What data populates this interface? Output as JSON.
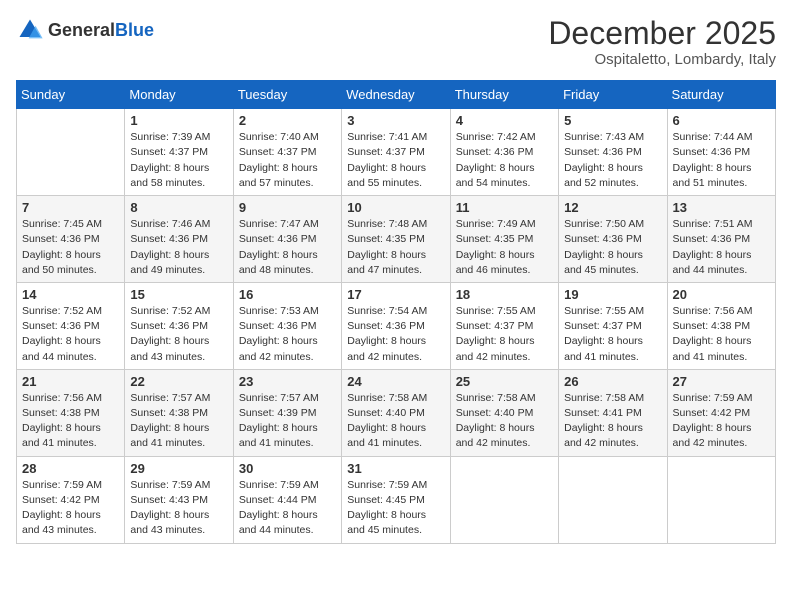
{
  "logo": {
    "general": "General",
    "blue": "Blue"
  },
  "title": "December 2025",
  "subtitle": "Ospitaletto, Lombardy, Italy",
  "days_of_week": [
    "Sunday",
    "Monday",
    "Tuesday",
    "Wednesday",
    "Thursday",
    "Friday",
    "Saturday"
  ],
  "weeks": [
    [
      {
        "day": "",
        "info": ""
      },
      {
        "day": "1",
        "info": "Sunrise: 7:39 AM\nSunset: 4:37 PM\nDaylight: 8 hours\nand 58 minutes."
      },
      {
        "day": "2",
        "info": "Sunrise: 7:40 AM\nSunset: 4:37 PM\nDaylight: 8 hours\nand 57 minutes."
      },
      {
        "day": "3",
        "info": "Sunrise: 7:41 AM\nSunset: 4:37 PM\nDaylight: 8 hours\nand 55 minutes."
      },
      {
        "day": "4",
        "info": "Sunrise: 7:42 AM\nSunset: 4:36 PM\nDaylight: 8 hours\nand 54 minutes."
      },
      {
        "day": "5",
        "info": "Sunrise: 7:43 AM\nSunset: 4:36 PM\nDaylight: 8 hours\nand 52 minutes."
      },
      {
        "day": "6",
        "info": "Sunrise: 7:44 AM\nSunset: 4:36 PM\nDaylight: 8 hours\nand 51 minutes."
      }
    ],
    [
      {
        "day": "7",
        "info": "Sunrise: 7:45 AM\nSunset: 4:36 PM\nDaylight: 8 hours\nand 50 minutes."
      },
      {
        "day": "8",
        "info": "Sunrise: 7:46 AM\nSunset: 4:36 PM\nDaylight: 8 hours\nand 49 minutes."
      },
      {
        "day": "9",
        "info": "Sunrise: 7:47 AM\nSunset: 4:36 PM\nDaylight: 8 hours\nand 48 minutes."
      },
      {
        "day": "10",
        "info": "Sunrise: 7:48 AM\nSunset: 4:35 PM\nDaylight: 8 hours\nand 47 minutes."
      },
      {
        "day": "11",
        "info": "Sunrise: 7:49 AM\nSunset: 4:35 PM\nDaylight: 8 hours\nand 46 minutes."
      },
      {
        "day": "12",
        "info": "Sunrise: 7:50 AM\nSunset: 4:36 PM\nDaylight: 8 hours\nand 45 minutes."
      },
      {
        "day": "13",
        "info": "Sunrise: 7:51 AM\nSunset: 4:36 PM\nDaylight: 8 hours\nand 44 minutes."
      }
    ],
    [
      {
        "day": "14",
        "info": "Sunrise: 7:52 AM\nSunset: 4:36 PM\nDaylight: 8 hours\nand 44 minutes."
      },
      {
        "day": "15",
        "info": "Sunrise: 7:52 AM\nSunset: 4:36 PM\nDaylight: 8 hours\nand 43 minutes."
      },
      {
        "day": "16",
        "info": "Sunrise: 7:53 AM\nSunset: 4:36 PM\nDaylight: 8 hours\nand 42 minutes."
      },
      {
        "day": "17",
        "info": "Sunrise: 7:54 AM\nSunset: 4:36 PM\nDaylight: 8 hours\nand 42 minutes."
      },
      {
        "day": "18",
        "info": "Sunrise: 7:55 AM\nSunset: 4:37 PM\nDaylight: 8 hours\nand 42 minutes."
      },
      {
        "day": "19",
        "info": "Sunrise: 7:55 AM\nSunset: 4:37 PM\nDaylight: 8 hours\nand 41 minutes."
      },
      {
        "day": "20",
        "info": "Sunrise: 7:56 AM\nSunset: 4:38 PM\nDaylight: 8 hours\nand 41 minutes."
      }
    ],
    [
      {
        "day": "21",
        "info": "Sunrise: 7:56 AM\nSunset: 4:38 PM\nDaylight: 8 hours\nand 41 minutes."
      },
      {
        "day": "22",
        "info": "Sunrise: 7:57 AM\nSunset: 4:38 PM\nDaylight: 8 hours\nand 41 minutes."
      },
      {
        "day": "23",
        "info": "Sunrise: 7:57 AM\nSunset: 4:39 PM\nDaylight: 8 hours\nand 41 minutes."
      },
      {
        "day": "24",
        "info": "Sunrise: 7:58 AM\nSunset: 4:40 PM\nDaylight: 8 hours\nand 41 minutes."
      },
      {
        "day": "25",
        "info": "Sunrise: 7:58 AM\nSunset: 4:40 PM\nDaylight: 8 hours\nand 42 minutes."
      },
      {
        "day": "26",
        "info": "Sunrise: 7:58 AM\nSunset: 4:41 PM\nDaylight: 8 hours\nand 42 minutes."
      },
      {
        "day": "27",
        "info": "Sunrise: 7:59 AM\nSunset: 4:42 PM\nDaylight: 8 hours\nand 42 minutes."
      }
    ],
    [
      {
        "day": "28",
        "info": "Sunrise: 7:59 AM\nSunset: 4:42 PM\nDaylight: 8 hours\nand 43 minutes."
      },
      {
        "day": "29",
        "info": "Sunrise: 7:59 AM\nSunset: 4:43 PM\nDaylight: 8 hours\nand 43 minutes."
      },
      {
        "day": "30",
        "info": "Sunrise: 7:59 AM\nSunset: 4:44 PM\nDaylight: 8 hours\nand 44 minutes."
      },
      {
        "day": "31",
        "info": "Sunrise: 7:59 AM\nSunset: 4:45 PM\nDaylight: 8 hours\nand 45 minutes."
      },
      {
        "day": "",
        "info": ""
      },
      {
        "day": "",
        "info": ""
      },
      {
        "day": "",
        "info": ""
      }
    ]
  ]
}
